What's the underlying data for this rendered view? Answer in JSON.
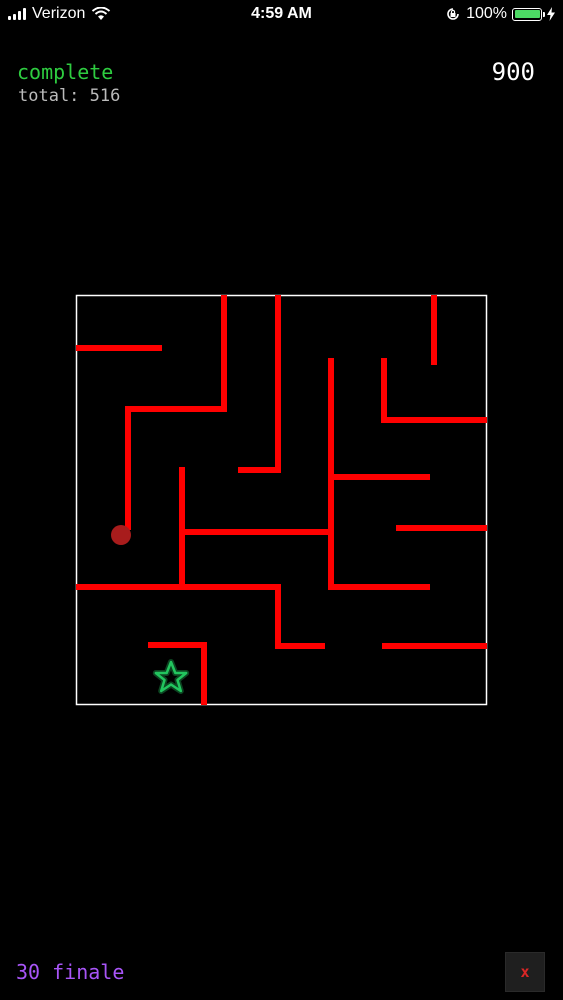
{
  "status_bar": {
    "carrier": "Verizon",
    "time": "4:59 AM",
    "battery_percent": "100%",
    "battery_level": 1.0
  },
  "game": {
    "status": "complete",
    "total_text": "total: 516",
    "score": "900",
    "level_label": "30 finale",
    "close_label": "x"
  },
  "colors": {
    "status": "#2ecc40",
    "walls": "#ff0000",
    "border": "#ffffff",
    "ball": "#a81c1c",
    "star": "#22c55e",
    "level_label": "#a855f7",
    "close": "#dc2626"
  },
  "icons": {
    "wifi": "wifi-icon",
    "orientation_lock": "orientation-lock-icon",
    "battery": "battery-icon",
    "charging": "charging-bolt-icon",
    "goal": "star-icon"
  }
}
